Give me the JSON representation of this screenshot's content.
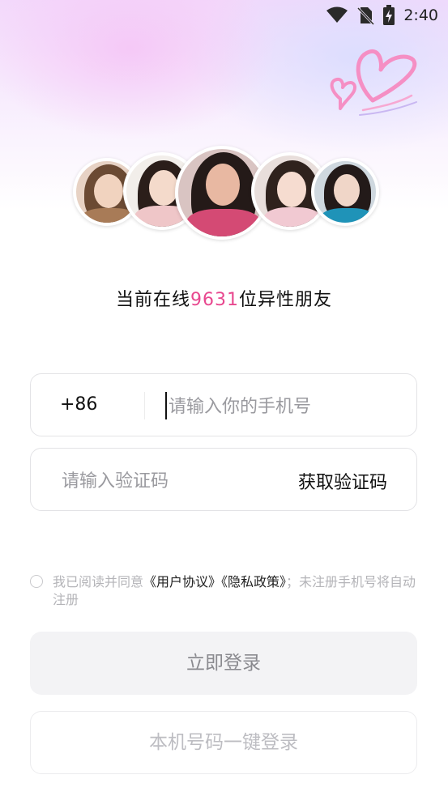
{
  "status_bar": {
    "time": "2:40",
    "icons": [
      "wifi-icon",
      "no-sim-icon",
      "battery-charging-icon"
    ]
  },
  "decoration": {
    "icon": "heart-doodle-icon"
  },
  "avatars": [
    "avatar-1",
    "avatar-2",
    "avatar-3",
    "avatar-4",
    "avatar-5"
  ],
  "online": {
    "prefix": "当前在线",
    "count": "9631",
    "suffix": "位异性朋友"
  },
  "phone_field": {
    "prefix": "+86",
    "placeholder": "请输入你的手机号"
  },
  "code_field": {
    "placeholder": "请输入验证码",
    "get_code_label": "获取验证码"
  },
  "agreement": {
    "text_1": "我已阅读并同意",
    "user_agreement": "《用户协议》",
    "privacy_policy": "《隐私政策》",
    "text_2": "；未注册手机号将自动注册",
    "checked": false
  },
  "buttons": {
    "login": "立即登录",
    "one_key_login": "本机号码一键登录"
  },
  "colors": {
    "accent": "#e8488f",
    "placeholder": "#9a9a9f",
    "button_bg": "#f3f3f5"
  }
}
